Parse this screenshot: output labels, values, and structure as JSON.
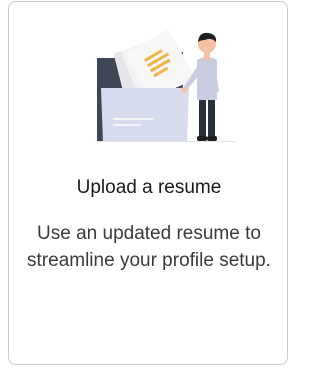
{
  "card": {
    "title": "Upload a resume",
    "description": "Use an updated resume to streamline your profile setup."
  },
  "colors": {
    "folder": "#3f4656",
    "folder_front": "#d8dcef",
    "paper": "#f0f0f2",
    "accent_lines": "#f2b544",
    "shirt": "#c9cbe0",
    "pants": "#2b2f3a",
    "hair": "#1f1f1f",
    "skin": "#f4c1a4",
    "border": "#c9c9c9"
  },
  "illustration": {
    "icon": "resume-upload-illustration"
  }
}
